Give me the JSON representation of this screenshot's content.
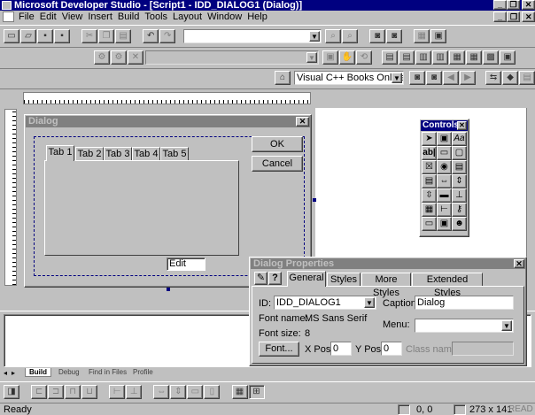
{
  "app": {
    "title": "Microsoft Developer Studio - [Script1 - IDD_DIALOG1 (Dialog)]",
    "title_buttons": [
      "_",
      "❐",
      "✕"
    ],
    "child_buttons": [
      "_",
      "❐",
      "✕"
    ]
  },
  "menu": [
    "File",
    "Edit",
    "View",
    "Insert",
    "Build",
    "Tools",
    "Layout",
    "Window",
    "Help"
  ],
  "toolbar": {
    "find_combo_value": "",
    "books_combo_value": "Visual C++ Books Online"
  },
  "dialog": {
    "title": "Dialog",
    "tabs": [
      "Tab 1",
      "Tab 2",
      "Tab 3",
      "Tab 4",
      "Tab 5"
    ],
    "ok_label": "OK",
    "cancel_label": "Cancel",
    "edit_label": "Edit"
  },
  "controls": {
    "title": "Controls",
    "icons": [
      "pointer-icon",
      "picture-icon",
      "static-text-icon",
      "edit-box-icon",
      "group-box-icon",
      "button-icon",
      "check-box-icon",
      "radio-button-icon",
      "combo-box-icon",
      "list-box-icon",
      "horizontal-scroll-icon",
      "vertical-scroll-icon",
      "spin-icon",
      "progress-icon",
      "slider-icon",
      "hotkey-icon",
      "list-control-icon",
      "tree-control-icon",
      "tab-control-icon",
      "animate-icon",
      "rich-edit-icon",
      "custom-control-icon"
    ]
  },
  "properties": {
    "title": "Dialog Properties",
    "tabs": [
      "General",
      "Styles",
      "More Styles",
      "Extended Styles"
    ],
    "id_label": "ID:",
    "id_value": "IDD_DIALOG1",
    "caption_label": "Caption:",
    "caption_value": "Dialog",
    "font_name_label": "Font name:",
    "font_name_value": "MS Sans Serif",
    "font_size_label": "Font size:",
    "font_size_value": "8",
    "menu_label": "Menu:",
    "menu_value": "",
    "font_button": "Font...",
    "xpos_label": "X Pos:",
    "xpos_value": "0",
    "ypos_label": "Y Pos:",
    "ypos_value": "0",
    "classname_label": "Class name:",
    "classname_value": ""
  },
  "output_tabs": [
    "Build",
    "Debug",
    "Find in Files",
    "Profile"
  ],
  "status": {
    "text": "Ready",
    "position": "0, 0",
    "size": "273 x 141",
    "mode": "READ"
  },
  "colors": {
    "titlebar": "#000080",
    "face": "#c0c0c0",
    "workspace": "#ffffff"
  }
}
